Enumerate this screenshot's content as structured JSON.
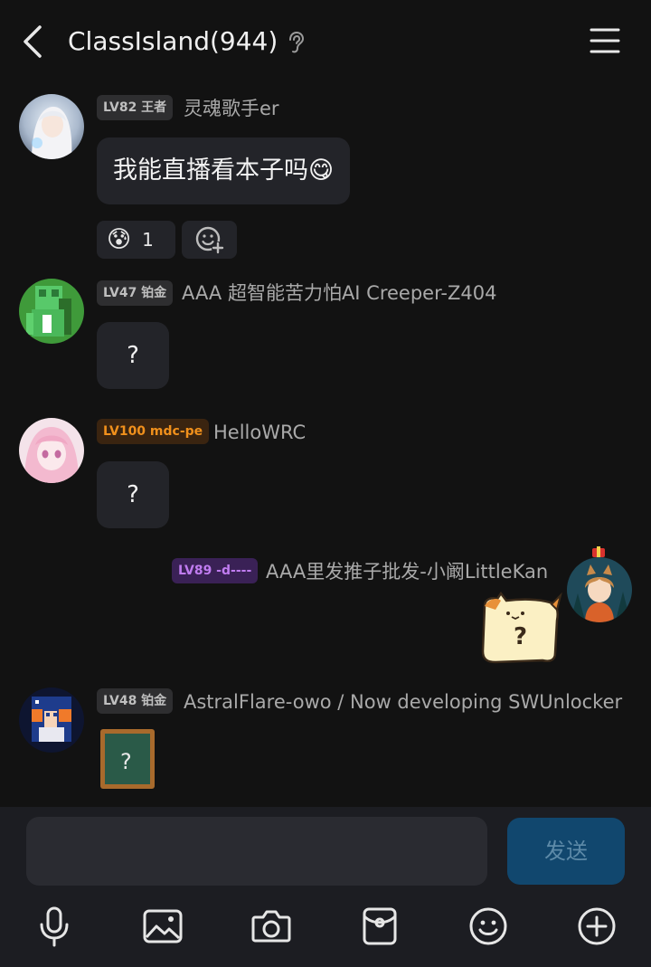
{
  "header": {
    "title": "ClassIsland(944)"
  },
  "messages": [
    {
      "level_badge": "LV82 王者",
      "name": "灵魂歌手er",
      "text": "我能直播看本子吗😋",
      "reaction": {
        "emoji": "😰",
        "count": "1"
      }
    },
    {
      "level_badge": "LV47 铂金",
      "name": "AAA 超智能苦力怕AI Creeper-Z404",
      "text": "?"
    },
    {
      "level_badge": "LV100 mdc-pe",
      "name": "HelloWRC",
      "text": "?"
    },
    {
      "level_badge": "LV89 -d----",
      "name": "AAA里发推子批发-小阚LittleKan",
      "sticker_text": "?"
    },
    {
      "level_badge": "LV48 铂金",
      "name": "AstralFlare-owo / Now developing SWUnlocker",
      "sticker_text": "?"
    }
  ],
  "input": {
    "placeholder": "",
    "send_label": "发送"
  },
  "toolbar": [
    "mic-icon",
    "image-icon",
    "camera-icon",
    "red-packet-icon",
    "emoji-icon",
    "plus-icon"
  ],
  "colors": {
    "background": "#121212",
    "bubble": "#232429",
    "send_button": "#11476e",
    "badge_orange": "#f0901c",
    "badge_purple": "#c07cf0"
  }
}
